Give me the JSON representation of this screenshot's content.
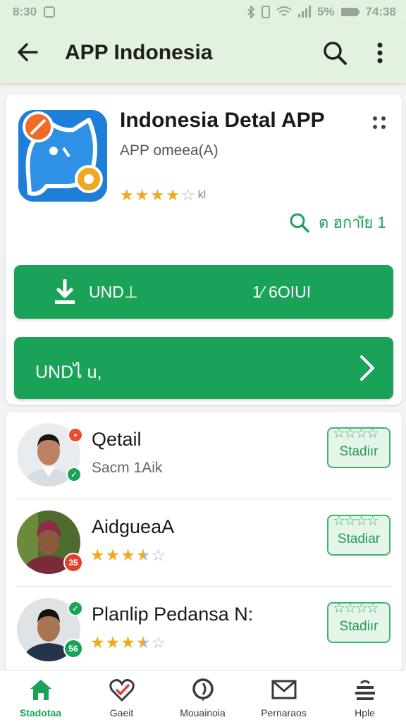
{
  "status_bar": {
    "time": "8:30",
    "battery": "5%",
    "clock_right": "74:38"
  },
  "app_bar": {
    "title": "APP Indonesia"
  },
  "app": {
    "name": "Indonesia Detal APP",
    "developer": "APP omeea(A)",
    "rating": 4,
    "rating_max": 5,
    "rating_count": "kl",
    "search_link": "ต ฮกาiัย 1",
    "accent_color": "#1aa358",
    "icon_color": "#1d7fd8"
  },
  "actions": {
    "install_label": "UND⊥",
    "install_size": "1⁄ 6OIUI",
    "secondary_label": "UNDไ u,"
  },
  "list": [
    {
      "name": "Qetail",
      "subtitle": "Sacm 1Aik",
      "rating": null,
      "button_label": "Stadiır",
      "badge_top": "#e8502a",
      "badge_bottom": "#1aa358"
    },
    {
      "name": "AidgueaA",
      "subtitle": "",
      "rating": 3.5,
      "button_label": "Stadiar",
      "badge_top": null,
      "badge_bottom": "#e04030",
      "badge_bottom_text": "35"
    },
    {
      "name": "Plaпlip Pedansa N:",
      "subtitle": "",
      "rating": 3.5,
      "button_label": "Stadiır",
      "badge_top": "#1aa358",
      "badge_bottom": "#1aa358",
      "badge_bottom_text": "56"
    }
  ],
  "bottom_nav": [
    {
      "label": "Stadotaa",
      "icon": "home-icon",
      "active": true
    },
    {
      "label": "Gaeit",
      "icon": "heart-check-icon",
      "active": false
    },
    {
      "label": "Mouainoia",
      "icon": "compass-icon",
      "active": false
    },
    {
      "label": "Pernaraos",
      "icon": "mail-icon",
      "active": false
    },
    {
      "label": "Hple",
      "icon": "layers-icon",
      "active": false
    }
  ]
}
